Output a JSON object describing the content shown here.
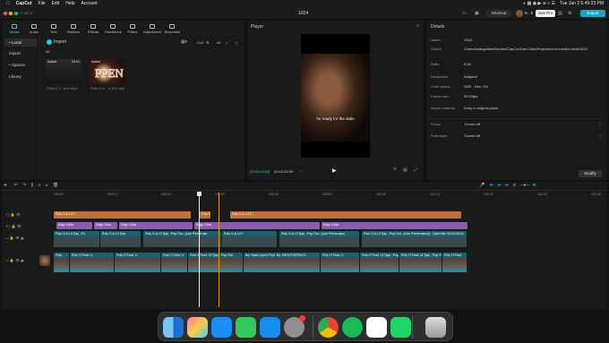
{
  "menubar": {
    "app": "CapCut",
    "file": "File",
    "edit": "Edit",
    "help": "Help",
    "account": "Account",
    "clock": "Tue Jan 2  5:49:23 PM"
  },
  "titlebar": {
    "autosave": "Auto saved: 17:49:14",
    "project": "1024",
    "shortcut": "Shortcut",
    "user": "K...k",
    "join_pro": "Join Pro",
    "export": "Export"
  },
  "media": {
    "tabs": [
      "Media",
      "Audio",
      "Text",
      "Stickers",
      "Effects",
      "Transitions",
      "Filters",
      "Adjustment",
      "Templates"
    ],
    "sidebar": [
      "• Local",
      "Import",
      "• Spaces",
      "Library"
    ],
    "import_label": "Import",
    "sort_label": "Sort",
    "all_label": "All",
    "section": "All",
    "items": [
      {
        "badge": "Added",
        "duration": "03:01",
        "name": "Polo G T...lyric.mp4"
      },
      {
        "badge": "Added",
        "duration": "",
        "name": "Polo G & ...ir (Of.mp4"
      }
    ]
  },
  "player": {
    "title": "Player",
    "subtitle": "he ready for the stain",
    "time_current": "00:00:13:03",
    "time_total": "00:03:34:09"
  },
  "details": {
    "title": "Details",
    "rows": [
      {
        "k": "Name:",
        "v": "1024"
      },
      {
        "k": "Saved:",
        "v": "/Users/kaangelitan/Movies/CapCut/User Data/Projects/com.lveditor.draft/1024"
      },
      {
        "k": "Ratio:",
        "v": "9:16"
      },
      {
        "k": "Resolution:",
        "v": "Adapted"
      },
      {
        "k": "Color space:",
        "v": "SDR - Rec.709"
      },
      {
        "k": "Frame rate:",
        "v": "30.00fps"
      },
      {
        "k": "Import material:",
        "v": "Keep in original place"
      }
    ],
    "rows2": [
      {
        "k": "Proxy:",
        "v": "Turned off"
      },
      {
        "k": "Free layer:",
        "v": "Turned off"
      }
    ],
    "modify": "Modify"
  },
  "timeline": {
    "ruler": [
      "100:00",
      "100:10",
      "100:20",
      "100:30",
      "100:40",
      "100:50",
      "101:00",
      "101:10",
      "101:20",
      "101:30",
      "101:40"
    ],
    "text_track_label": "Polo G & Lil T...",
    "edge_glow": "Edge Glow",
    "video_clip_labels": [
      "Polo G & Lil Tjay ..Po",
      "Polo G & Lil Tjay",
      "Polo G & Lil Tjay ..Pop Out...[Live Performan",
      "Polo G & Lil T",
      "Polo G & Lil Tjay ..Pop Out...[Live Performanc",
      "Polo G & Lil Tjay ..Pop Out...[Live Performance]...Open Mic  00:00:03:03"
    ],
    "main_clip_labels": [
      "Polo",
      "Polo G Feat. Li",
      "Polo G Feat. Li",
      "Polo G Feat. Li",
      "Polo G Feat. Lil Tjay - Pop Out",
      "Ba: Ryan Lynch Prod. By JOENTHATRACK  ..",
      "Polo G Feat. Li",
      "Polo G Feat. Lil Tjay - Pop Out",
      "Polo G Feat. Lil Tjay - Pop Out",
      "Polo G Feat."
    ]
  }
}
